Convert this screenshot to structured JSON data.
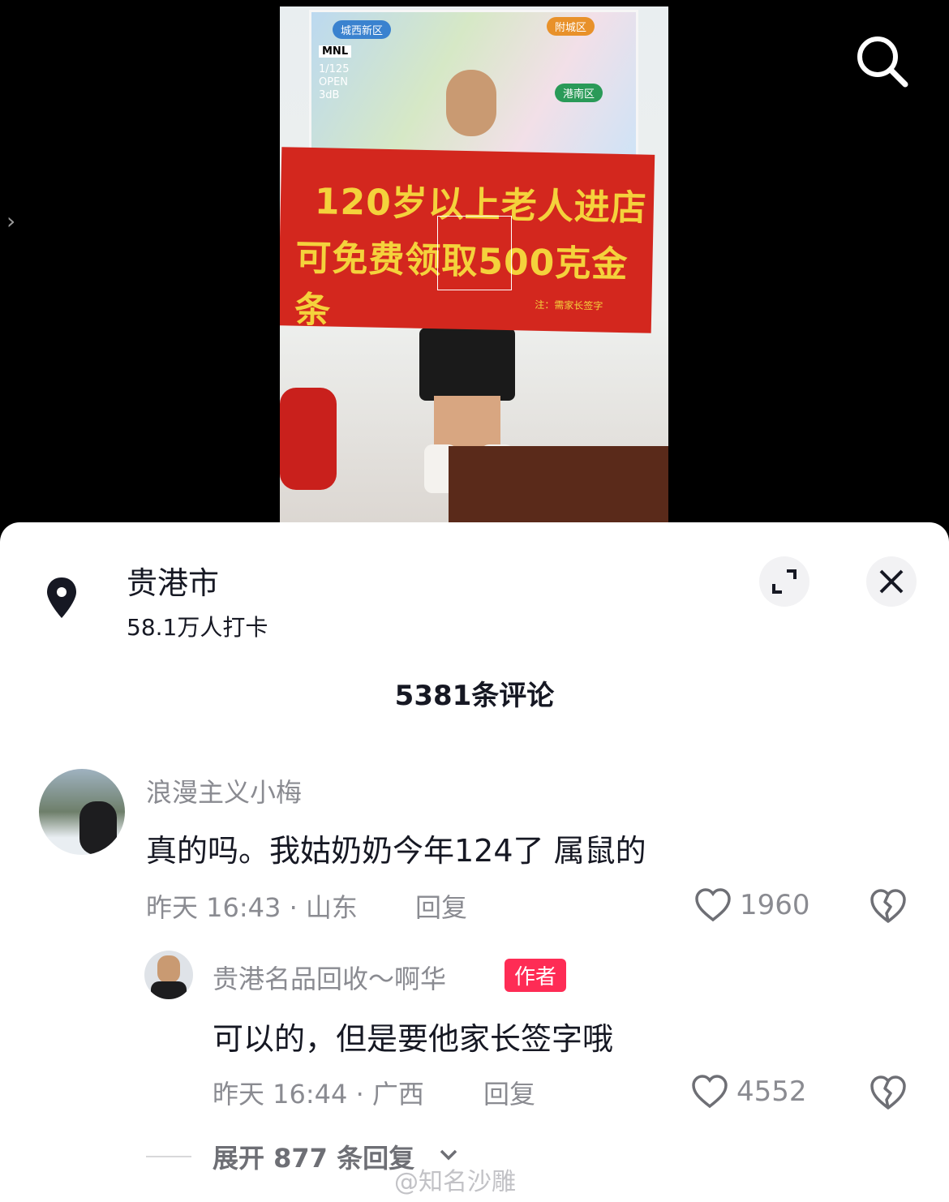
{
  "video": {
    "map_tags": [
      "城西新区",
      "附城区",
      "港南区"
    ],
    "banner_line1": "120岁以上老人进店",
    "banner_line2": "可免费领取500克金条",
    "banner_note": "注：需家长签字",
    "camera_badge": "MNL",
    "camera_info": "1/125\nOPEN\n3dB"
  },
  "location": {
    "title": "贵港市",
    "checkins": "58.1万人打卡"
  },
  "comments_header": "5381条评论",
  "comments": [
    {
      "username": "浪漫主义小梅",
      "text": "真的吗。我姑奶奶今年124了 属鼠的",
      "meta": "昨天 16:43 · 山东",
      "reply_label": "回复",
      "likes": "1960"
    }
  ],
  "reply": {
    "username": "贵港名品回收～啊华",
    "badge": "作者",
    "text": "可以的，但是要他家长签字哦",
    "meta": "昨天 16:44 · 广西",
    "reply_label": "回复",
    "likes": "4552"
  },
  "expand_label": "展开 877 条回复",
  "watermark": "@知名沙雕",
  "colors": {
    "accent": "#fe2c55",
    "text": "#161823",
    "muted": "#8a8b91"
  }
}
